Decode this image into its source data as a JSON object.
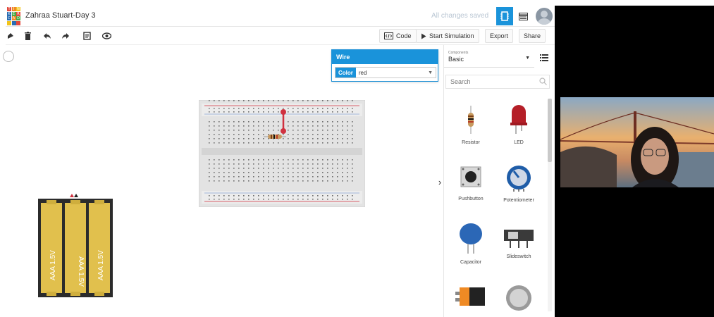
{
  "header": {
    "logo_letters": [
      "T",
      "I",
      "N",
      "K",
      "E",
      "R",
      "C",
      "A",
      "D",
      "",
      "",
      ""
    ],
    "project_title": "Zahraa Stuart-Day 3",
    "save_status": "All changes saved"
  },
  "toolbar": {
    "code_label": "Code",
    "simulate_label": "Start Simulation",
    "export_label": "Export",
    "share_label": "Share"
  },
  "wire_panel": {
    "title": "Wire",
    "color_label": "Color",
    "color_value": "red"
  },
  "components": {
    "category_label": "Components",
    "category_value": "Basic",
    "search_placeholder": "Search",
    "items": [
      {
        "label": "Resistor",
        "icon": "resistor-icon"
      },
      {
        "label": "LED",
        "icon": "led-icon"
      },
      {
        "label": "Pushbutton",
        "icon": "pushbutton-icon"
      },
      {
        "label": "Potentiometer",
        "icon": "potentiometer-icon"
      },
      {
        "label": "Capacitor",
        "icon": "capacitor-icon"
      },
      {
        "label": "Slideswitch",
        "icon": "slideswitch-icon"
      },
      {
        "label": "",
        "icon": "battery-9v-icon"
      },
      {
        "label": "",
        "icon": "coin-cell-icon"
      }
    ]
  },
  "battery_pack": {
    "cells": [
      "AAA 1.5V",
      "AAA 1.5V",
      "AAA 1.5V"
    ]
  },
  "colors": {
    "accent": "#1a93da",
    "wire": "#d0313f",
    "battery": "#e1c04d",
    "battery_case": "#2b2b2b"
  }
}
